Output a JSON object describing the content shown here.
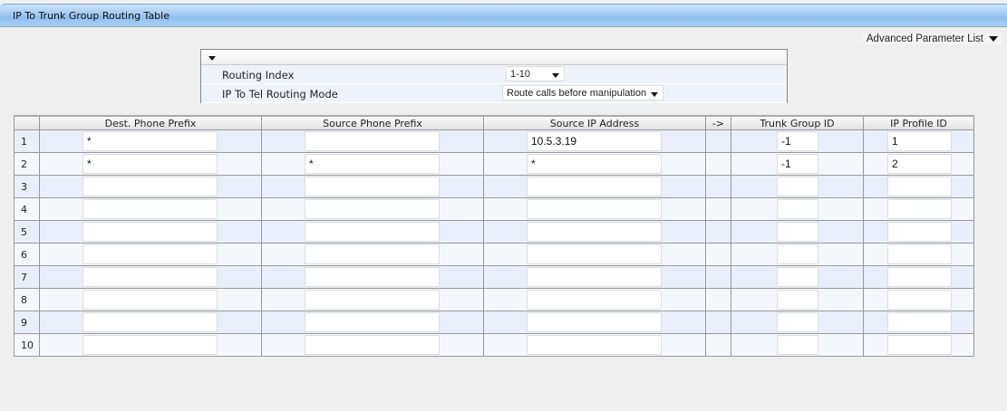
{
  "title": "IP To Trunk Group Routing Table",
  "advanced_link": "Advanced Parameter List",
  "params": {
    "routing_index_label": "Routing Index",
    "routing_index_value": "1-10",
    "mode_label": "IP To Tel Routing Mode",
    "mode_value": "Route calls before manipulation"
  },
  "columns": [
    "",
    "Dest. Phone Prefix",
    "Source Phone Prefix",
    "Source IP Address",
    "->",
    "Trunk Group ID",
    "IP Profile ID"
  ],
  "rows": [
    {
      "idx": "1",
      "dest": "*",
      "src_phone": "",
      "src_ip": "10.5.3.19",
      "trunk": "-1",
      "profile": "1"
    },
    {
      "idx": "2",
      "dest": "*",
      "src_phone": "*",
      "src_ip": "*",
      "trunk": "-1",
      "profile": "2"
    },
    {
      "idx": "3",
      "dest": "",
      "src_phone": "",
      "src_ip": "",
      "trunk": "",
      "profile": ""
    },
    {
      "idx": "4",
      "dest": "",
      "src_phone": "",
      "src_ip": "",
      "trunk": "",
      "profile": ""
    },
    {
      "idx": "5",
      "dest": "",
      "src_phone": "",
      "src_ip": "",
      "trunk": "",
      "profile": ""
    },
    {
      "idx": "6",
      "dest": "",
      "src_phone": "",
      "src_ip": "",
      "trunk": "",
      "profile": ""
    },
    {
      "idx": "7",
      "dest": "",
      "src_phone": "",
      "src_ip": "",
      "trunk": "",
      "profile": ""
    },
    {
      "idx": "8",
      "dest": "",
      "src_phone": "",
      "src_ip": "",
      "trunk": "",
      "profile": ""
    },
    {
      "idx": "9",
      "dest": "",
      "src_phone": "",
      "src_ip": "",
      "trunk": "",
      "profile": ""
    },
    {
      "idx": "10",
      "dest": "",
      "src_phone": "",
      "src_ip": "",
      "trunk": "",
      "profile": ""
    }
  ]
}
